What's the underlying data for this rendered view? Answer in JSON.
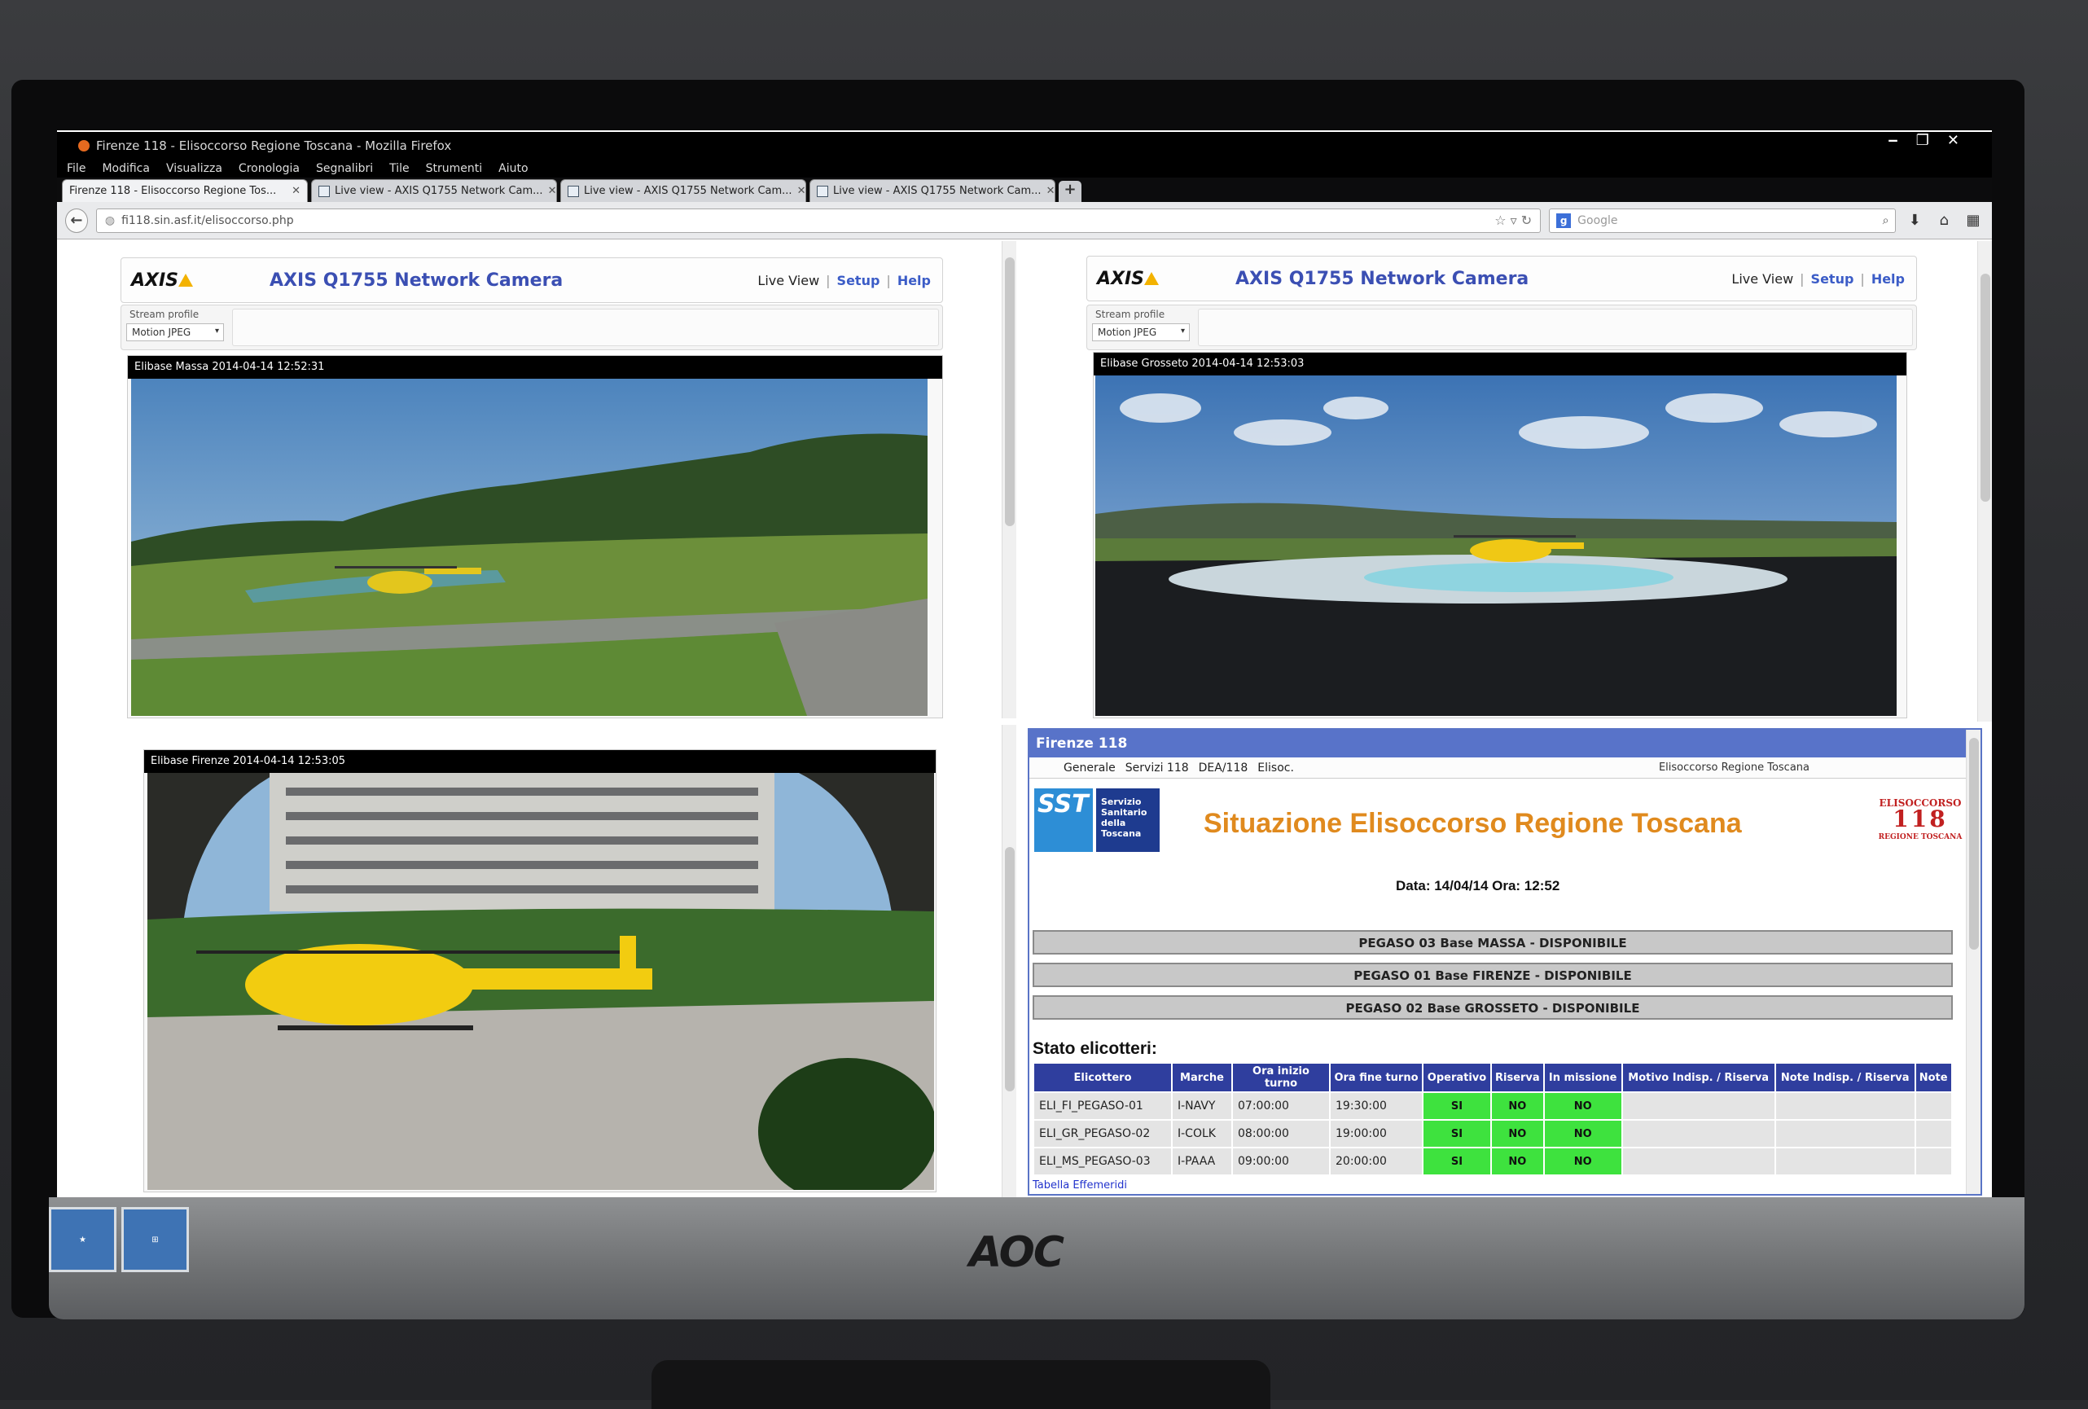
{
  "window": {
    "title": "Firenze 118 - Elisoccorso Regione Toscana - Mozilla Firefox",
    "controls": [
      "‒",
      "❐",
      "✕"
    ]
  },
  "menu": [
    "File",
    "Modifica",
    "Visualizza",
    "Cronologia",
    "Segnalibri",
    "Tile",
    "Strumenti",
    "Aiuto"
  ],
  "tabs": [
    {
      "label": "Firenze 118 - Elisoccorso Regione Tos...",
      "active": true
    },
    {
      "label": "Live view - AXIS Q1755 Network Cam...",
      "active": false
    },
    {
      "label": "Live view - AXIS Q1755 Network Cam...",
      "active": false
    },
    {
      "label": "Live view - AXIS Q1755 Network Cam...",
      "active": false
    }
  ],
  "address": {
    "url": "fi118.sin.asf.it/elisoccorso.php",
    "search_placeholder": "Google"
  },
  "camera": {
    "title": "AXIS Q1755 Network Camera",
    "logo": "AXIS",
    "live_view": "Live View",
    "setup": "Setup",
    "help": "Help",
    "sep": "|",
    "stream_profile_label": "Stream profile",
    "stream_profile_value": "Motion JPEG"
  },
  "feeds": [
    {
      "caption": "Elibase Massa 2014-04-14 12:52:31"
    },
    {
      "caption": "Elibase Grosseto 2014-04-14 12:53:03"
    },
    {
      "caption": "Elibase Firenze 2014-04-14 12:53:05"
    }
  ],
  "dashboard": {
    "header": "Firenze 118",
    "nav": [
      "Generale",
      "Servizi 118",
      "DEA/118",
      "Elisoc."
    ],
    "nav_right": "Elisoccorso Regione Toscana",
    "sst_logo": "SST",
    "sst_text": "Servizio Sanitario della Toscana",
    "title": "Situazione Elisoccorso Regione Toscana",
    "eli_logo_top": "ELISOCCORSO",
    "eli_logo_num": "118",
    "eli_logo_bottom": "REGIONE TOSCANA",
    "date_line": "Data: 14/04/14 Ora: 12:52",
    "status_rows": [
      "PEGASO 03 Base MASSA - DISPONIBILE",
      "PEGASO 01 Base FIRENZE - DISPONIBILE",
      "PEGASO 02 Base GROSSETO - DISPONIBILE"
    ],
    "table_heading": "Stato elicotteri:",
    "columns": [
      "Elicottero",
      "Marche",
      "Ora inizio turno",
      "Ora fine turno",
      "Operativo",
      "Riserva",
      "In missione",
      "Motivo Indisp. / Riserva",
      "Note Indisp. / Riserva",
      "Note"
    ],
    "rows": [
      [
        "ELI_FI_PEGASO-01",
        "I-NAVY",
        "07:00:00",
        "19:30:00",
        "SI",
        "NO",
        "NO",
        "",
        "",
        ""
      ],
      [
        "ELI_GR_PEGASO-02",
        "I-COLK",
        "08:00:00",
        "19:00:00",
        "SI",
        "NO",
        "NO",
        "",
        "",
        ""
      ],
      [
        "ELI_MS_PEGASO-03",
        "I-PAAA",
        "09:00:00",
        "20:00:00",
        "SI",
        "NO",
        "NO",
        "",
        "",
        ""
      ]
    ],
    "footer_link": "Tabella Effemeridi"
  },
  "monitor": {
    "brand": "AOC"
  }
}
